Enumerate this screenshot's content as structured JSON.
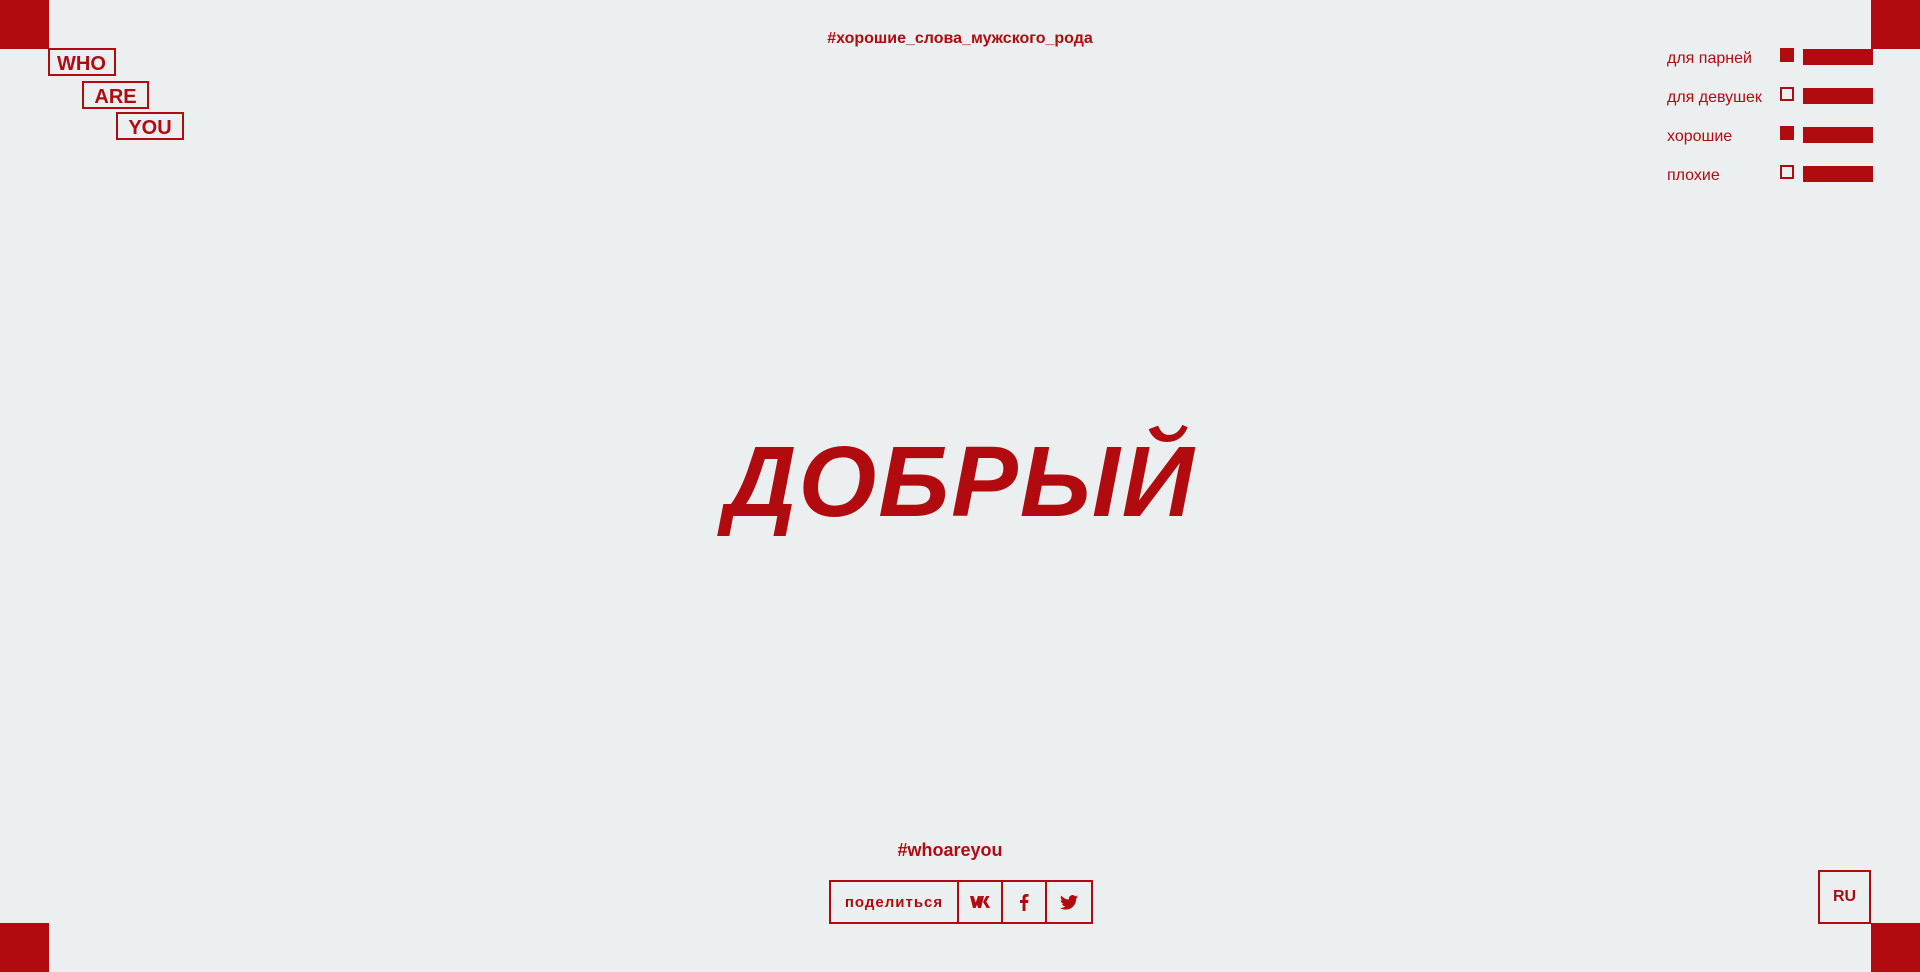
{
  "colors": {
    "accent": "#b20b0f",
    "background": "#ebeff0"
  },
  "logo": {
    "line1": "WHO",
    "line2": "ARE",
    "line3": "YOU"
  },
  "header": {
    "hashtag": "#хорошие_слова_мужского_рода"
  },
  "filters": [
    {
      "label": "для парней",
      "checked": true
    },
    {
      "label": "для девушек",
      "checked": false
    },
    {
      "label": "хорошие",
      "checked": true
    },
    {
      "label": "плохие",
      "checked": false
    }
  ],
  "main": {
    "word": "ДОБРЫЙ"
  },
  "footer": {
    "hashtag": "#whoareyou",
    "share_label": "поделиться",
    "social_icons": [
      "vk-icon",
      "facebook-icon",
      "twitter-icon"
    ],
    "language": "RU"
  }
}
